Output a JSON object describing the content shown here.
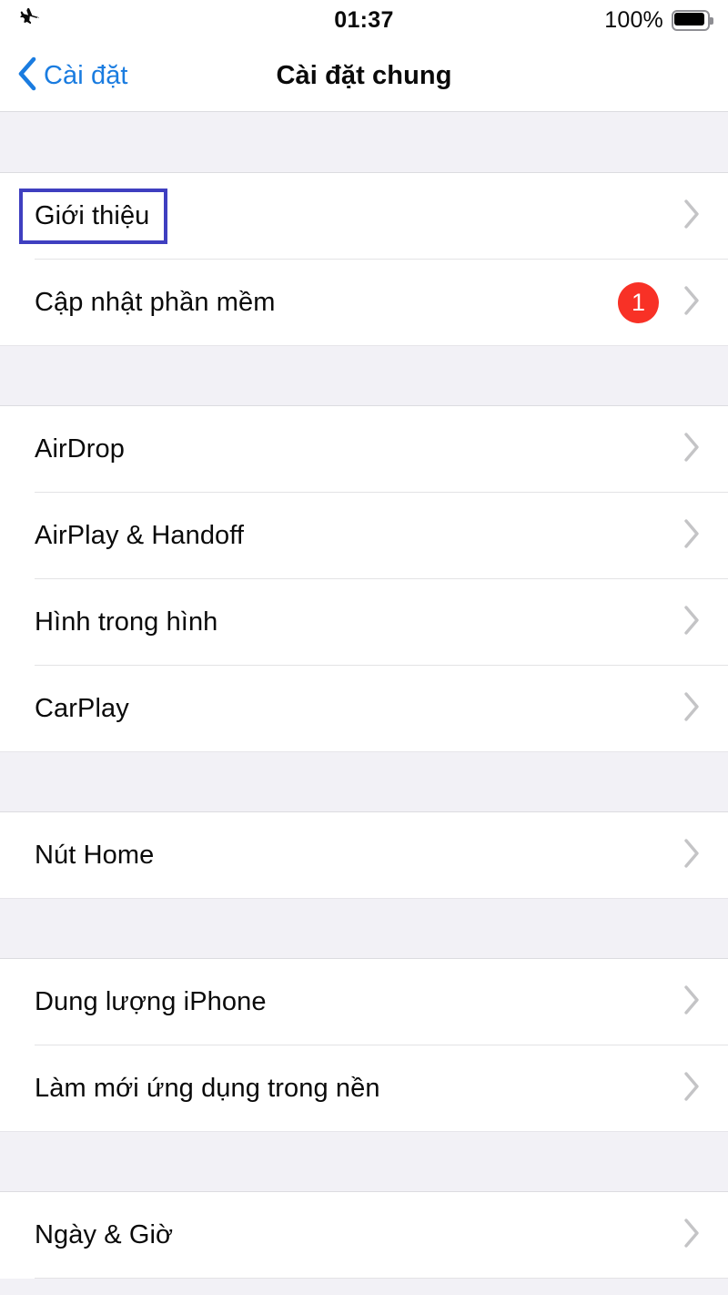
{
  "status_bar": {
    "airplane_icon": "airplane-mode-icon",
    "time": "01:37",
    "battery_percent": "100%",
    "battery_icon": "battery-full-icon"
  },
  "nav_bar": {
    "back_icon": "chevron-left-icon",
    "back_label": "Cài đặt",
    "title": "Cài đặt chung"
  },
  "colors": {
    "accent_blue": "#1a7ce0",
    "badge_red": "#f83126",
    "highlight_box": "#3f3fc0",
    "group_background": "#f2f1f6",
    "chevron_gray": "#c4c4c6"
  },
  "sections": [
    {
      "rows": [
        {
          "label": "Giới thiệu",
          "badge": null,
          "chevron": "chevron-right-icon",
          "highlighted": true
        },
        {
          "label": "Cập nhật phần mềm",
          "badge": "1",
          "chevron": "chevron-right-icon",
          "highlighted": false
        }
      ]
    },
    {
      "rows": [
        {
          "label": "AirDrop",
          "badge": null,
          "chevron": "chevron-right-icon",
          "highlighted": false
        },
        {
          "label": "AirPlay & Handoff",
          "badge": null,
          "chevron": "chevron-right-icon",
          "highlighted": false
        },
        {
          "label": "Hình trong hình",
          "badge": null,
          "chevron": "chevron-right-icon",
          "highlighted": false
        },
        {
          "label": "CarPlay",
          "badge": null,
          "chevron": "chevron-right-icon",
          "highlighted": false
        }
      ]
    },
    {
      "rows": [
        {
          "label": "Nút Home",
          "badge": null,
          "chevron": "chevron-right-icon",
          "highlighted": false
        }
      ]
    },
    {
      "rows": [
        {
          "label": "Dung lượng iPhone",
          "badge": null,
          "chevron": "chevron-right-icon",
          "highlighted": false
        },
        {
          "label": "Làm mới ứng dụng trong nền",
          "badge": null,
          "chevron": "chevron-right-icon",
          "highlighted": false
        }
      ]
    },
    {
      "rows": [
        {
          "label": "Ngày & Giờ",
          "badge": null,
          "chevron": "chevron-right-icon",
          "highlighted": false
        }
      ]
    }
  ]
}
